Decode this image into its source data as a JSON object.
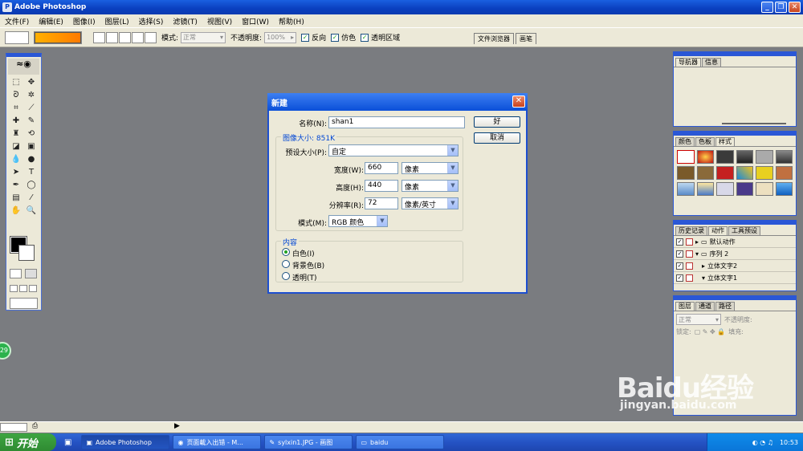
{
  "app": {
    "title": "Adobe Photoshop"
  },
  "menubar": [
    "文件(F)",
    "编辑(E)",
    "图像(I)",
    "图层(L)",
    "选择(S)",
    "滤镜(T)",
    "视图(V)",
    "窗口(W)",
    "帮助(H)"
  ],
  "options": {
    "mode_label": "模式:",
    "mode_value": "正常",
    "opacity_label": "不透明度:",
    "opacity_value": "100%",
    "reverse_label": "反向",
    "dither_label": "仿色",
    "transparency_label": "透明区域"
  },
  "palette_well": [
    "文件浏览器",
    "画笔"
  ],
  "dialog": {
    "title": "新建",
    "name_label": "名称(N):",
    "name_value": "shan1",
    "ok_label": "好",
    "cancel_label": "取消",
    "image_size_title": "图像大小: 851K",
    "preset_label": "预设大小(P):",
    "preset_value": "自定",
    "width_label": "宽度(W):",
    "width_value": "660",
    "width_unit": "像素",
    "height_label": "高度(H):",
    "height_value": "440",
    "height_unit": "像素",
    "resolution_label": "分辨率(R):",
    "resolution_value": "72",
    "resolution_unit": "像素/英寸",
    "mode_label": "模式(M):",
    "mode_value": "RGB 颜色",
    "content_title": "内容",
    "content_options": [
      "白色(I)",
      "背景色(B)",
      "透明(T)"
    ],
    "content_selected": "白色(I)"
  },
  "panels": {
    "navigator_tabs": [
      "导航器",
      "信息"
    ],
    "color_tabs": [
      "颜色",
      "色板",
      "样式"
    ],
    "history_tabs": [
      "历史记录",
      "动作",
      "工具预设"
    ],
    "actions": [
      "默认动作",
      "序列 2",
      "立体文字2",
      "立体文字1"
    ],
    "layers_tabs": [
      "图层",
      "通道",
      "路径"
    ],
    "layers_mode": "正常",
    "layers_opacity_label": "不透明度:",
    "layers_lock_label": "锁定:",
    "layers_fill_label": "填充:"
  },
  "badge": "29",
  "taskbar": {
    "start_label": "开始",
    "tasks": [
      "Adobe Photoshop",
      "页面載入出错 - M...",
      "sylxin1.JPG - 画图",
      "baidu"
    ],
    "clock": "10:53"
  },
  "watermark": {
    "logo": "Baidu经验",
    "url": "jingyan.baidu.com"
  }
}
